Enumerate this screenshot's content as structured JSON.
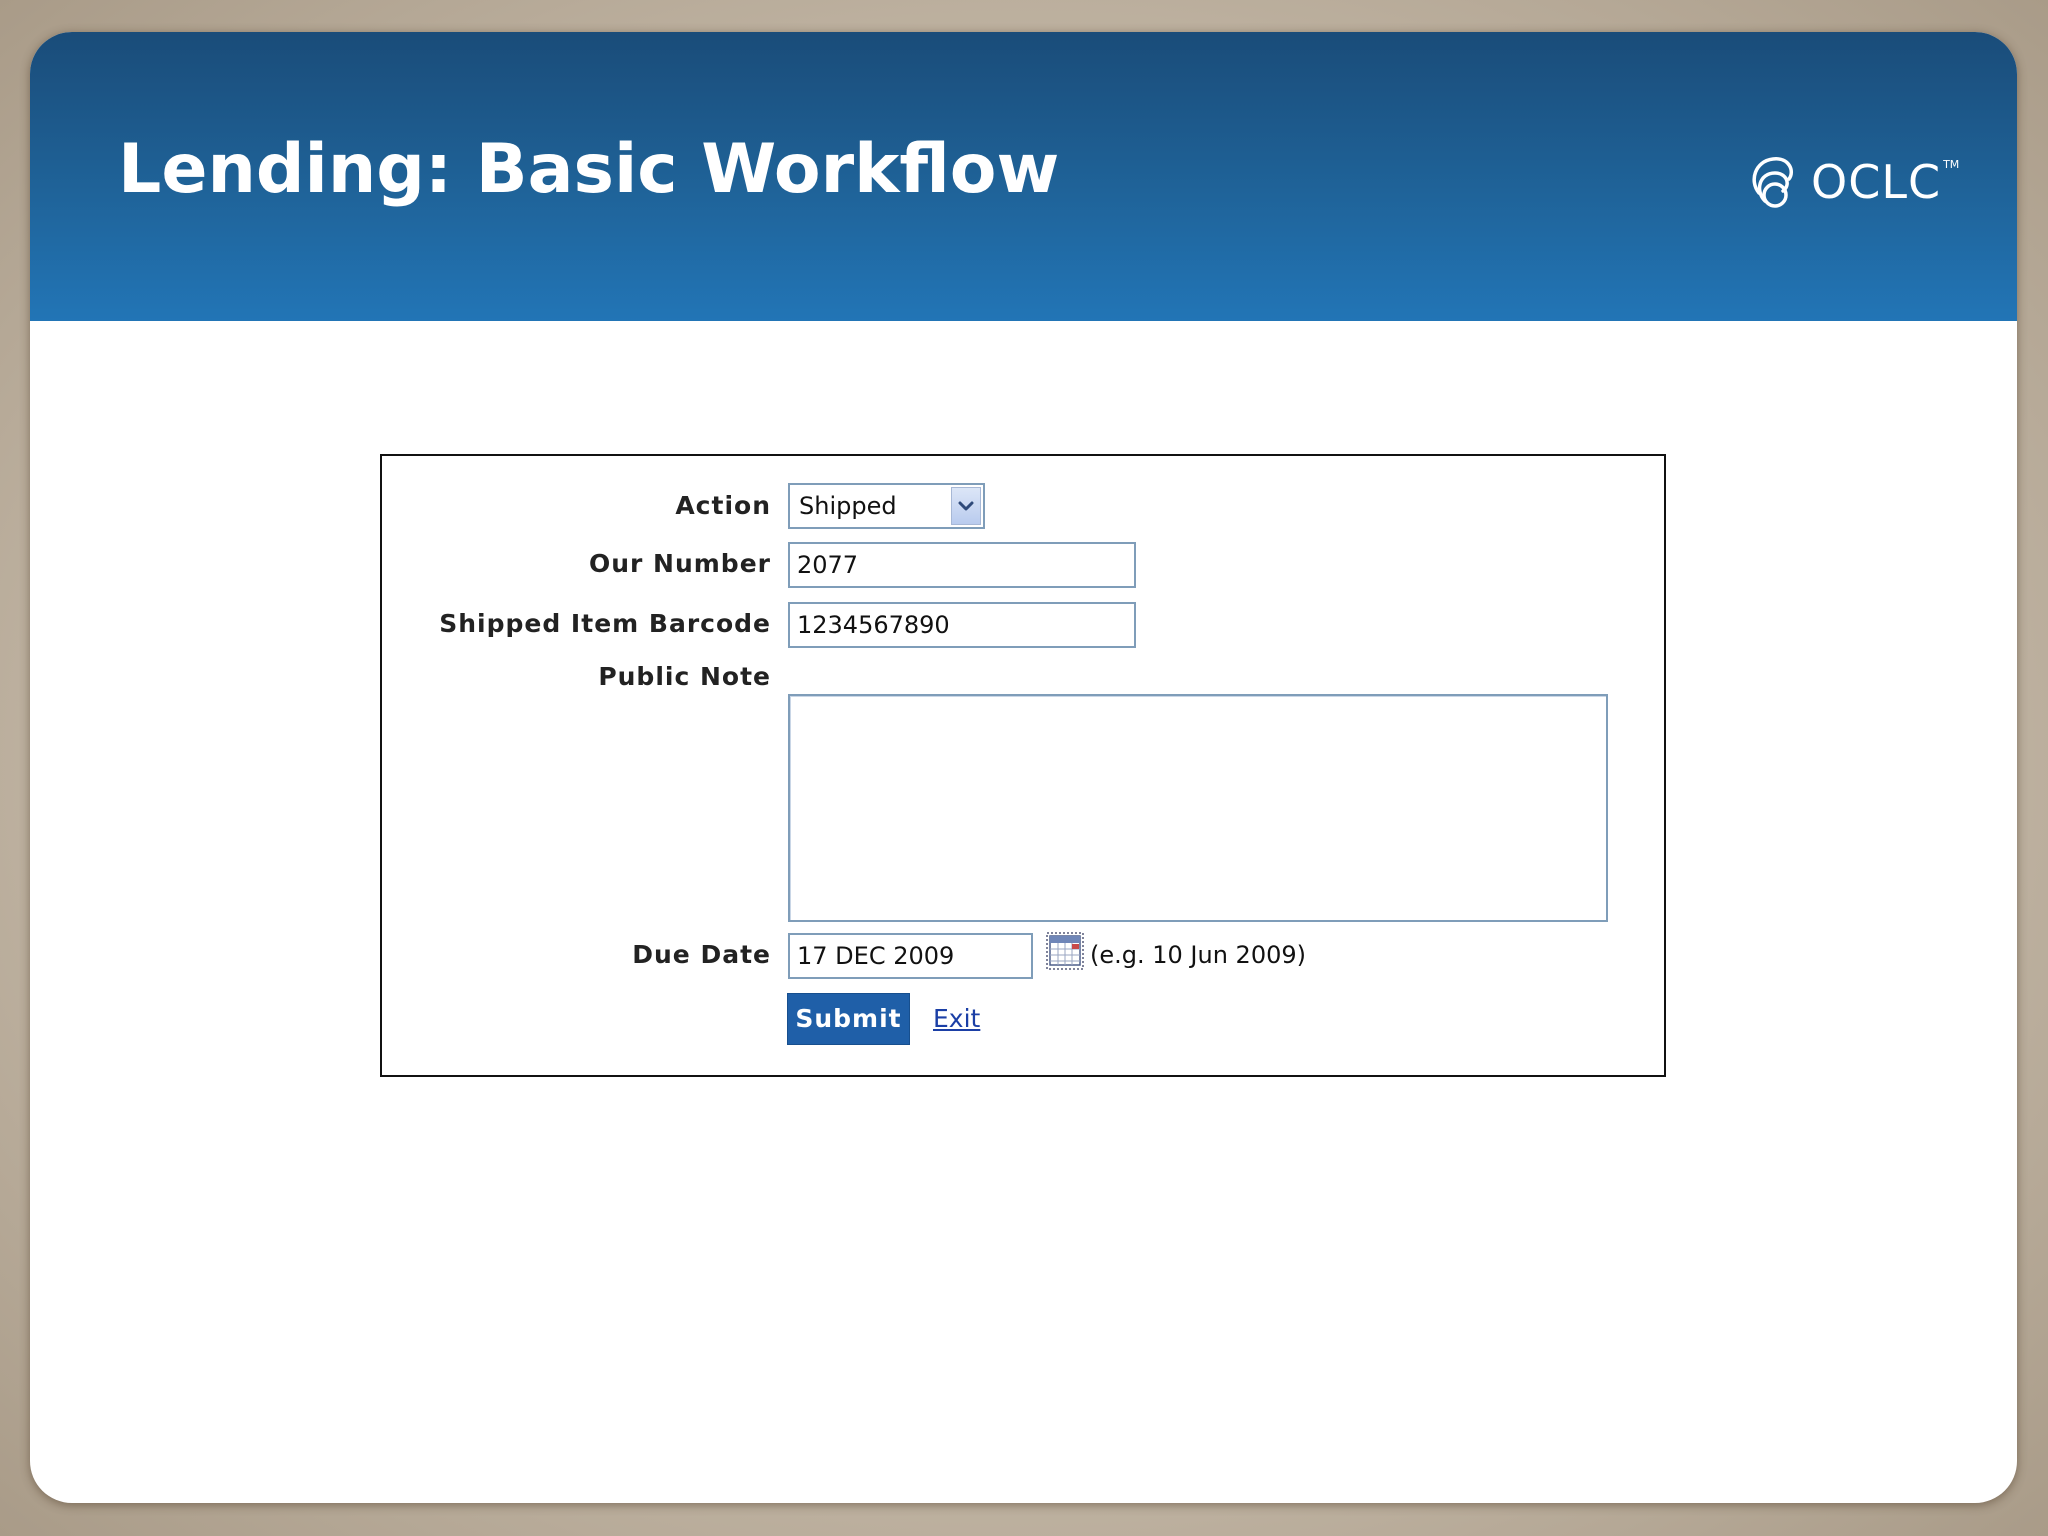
{
  "slide": {
    "title": "Lending: Basic Workflow",
    "logo": {
      "text": "OCLC",
      "trademark": "TM",
      "icon": "oclc-logo-mark-icon"
    }
  },
  "colors": {
    "header_top": "#1a4c79",
    "header_bottom": "#2275b6",
    "button": "#1f5fa8",
    "link": "#1b3fa6",
    "field_border": "#7f9db9"
  },
  "form": {
    "action": {
      "label": "Action",
      "selected": "Shipped",
      "icon": "chevron-down-icon"
    },
    "our_number": {
      "label": "Our Number",
      "value": "2077"
    },
    "shipped_item_barcode": {
      "label": "Shipped Item Barcode",
      "value": "1234567890"
    },
    "public_note": {
      "label": "Public Note",
      "value": ""
    },
    "due_date": {
      "label": "Due Date",
      "value": "17 DEC 2009",
      "hint": "(e.g. 10 Jun 2009)",
      "icon": "calendar-icon"
    },
    "submit_label": "Submit",
    "exit_label": "Exit"
  }
}
